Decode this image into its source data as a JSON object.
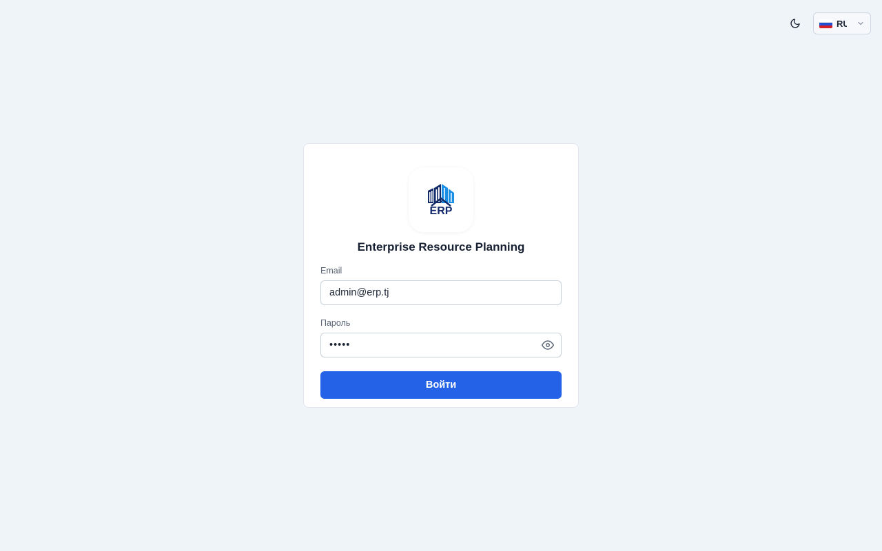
{
  "header": {
    "theme_icon": "moon-icon",
    "language": {
      "code": "RU",
      "flag_icon": "russia-flag-icon",
      "flag_colors": [
        "#ffffff",
        "#1c4fd1",
        "#d5202a"
      ],
      "chevron_icon": "chevron-down-icon"
    }
  },
  "login": {
    "logo_icon": "erp-logo-icon",
    "logo_text": "ERP",
    "title": "Enterprise Resource Planning",
    "email_label": "Email",
    "email_value": "admin@erp.tj",
    "password_label": "Пароль",
    "password_mask": "•••••",
    "password_toggle_icon": "eye-icon",
    "submit_label": "Войти"
  },
  "colors": {
    "background": "#eff4f9",
    "primary": "#2463e7",
    "logo_dark": "#132a6b",
    "logo_light": "#1a8fe3"
  }
}
